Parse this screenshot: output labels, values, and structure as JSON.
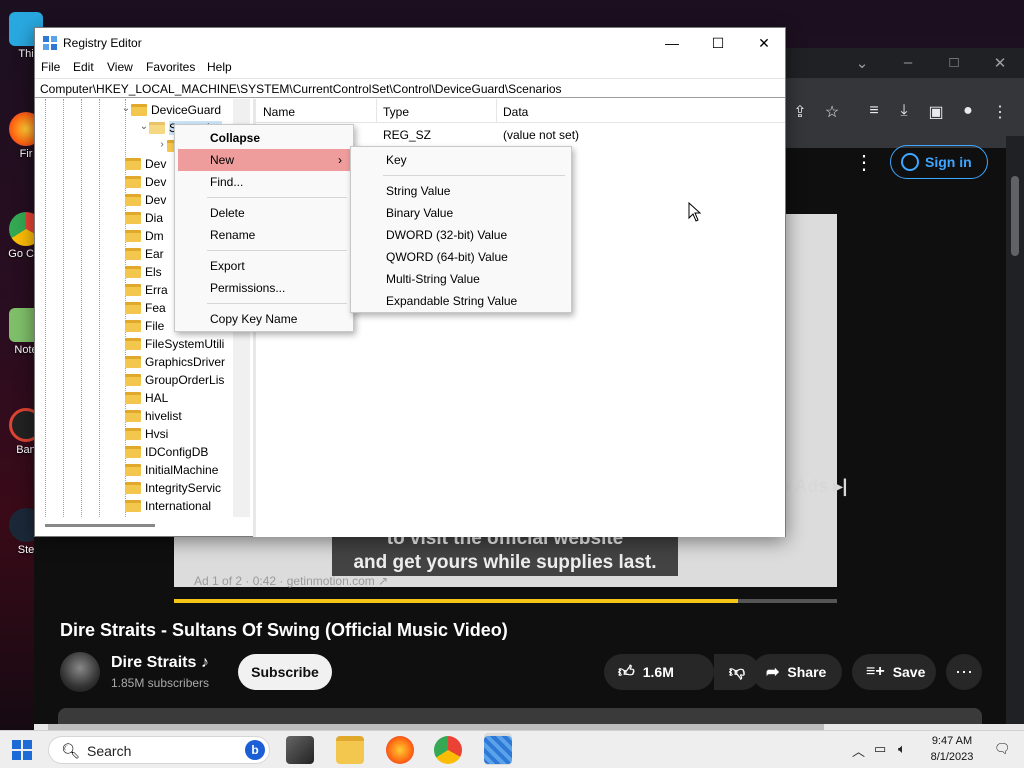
{
  "desktop": {
    "icons": [
      {
        "label": "Thi"
      },
      {
        "label": "Fir"
      },
      {
        "label": "Go Chr"
      },
      {
        "label": "Note"
      },
      {
        "label": "Ban"
      },
      {
        "label": "Ste"
      }
    ]
  },
  "browser": {
    "sign_in": "Sign in",
    "skip_ads": "ip Ads ▸|",
    "caption_line1": "to visit the official website",
    "caption_line2": "and get yours while supplies last.",
    "ad_info": "Ad 1 of 2 · 0:42 · getinmotion.com ↗",
    "progress": 0.85,
    "video_title": "Dire Straits - Sultans Of Swing (Official Music Video)",
    "channel_name": "Dire Straits ♪",
    "subscribers": "1.85M subscribers",
    "subscribe": "Subscribe",
    "likes": "1.6M",
    "share": "Share",
    "save": "Save"
  },
  "regedit": {
    "title": "Registry Editor",
    "menu": [
      "File",
      "Edit",
      "View",
      "Favorites",
      "Help"
    ],
    "address": "Computer\\HKEY_LOCAL_MACHINE\\SYSTEM\\CurrentControlSet\\Control\\DeviceGuard\\Scenarios",
    "tree": [
      {
        "label": "DeviceGuard",
        "expanded": true
      },
      {
        "label": "Scenarios",
        "expanded": true
      },
      {
        "label": "",
        "expanded": false
      },
      {
        "label": "Dev",
        "expanded": false
      },
      {
        "label": "Dev",
        "expanded": false
      },
      {
        "label": "Dev",
        "expanded": false
      },
      {
        "label": "Dia",
        "expanded": false
      },
      {
        "label": "Dm",
        "expanded": false
      },
      {
        "label": "Ear",
        "expanded": false
      },
      {
        "label": "Els",
        "expanded": false
      },
      {
        "label": "Erra",
        "expanded": false
      },
      {
        "label": "Fea",
        "expanded": false
      },
      {
        "label": "File",
        "expanded": false
      },
      {
        "label": "FileSystemUtili",
        "expanded": false
      },
      {
        "label": "GraphicsDriver",
        "expanded": false
      },
      {
        "label": "GroupOrderLis",
        "expanded": false
      },
      {
        "label": "HAL",
        "expanded": false
      },
      {
        "label": "hivelist",
        "expanded": false
      },
      {
        "label": "Hvsi",
        "expanded": false
      },
      {
        "label": "IDConfigDB",
        "expanded": false
      },
      {
        "label": "InitialMachine",
        "expanded": false
      },
      {
        "label": "IntegrityServic",
        "expanded": false
      },
      {
        "label": "International",
        "expanded": false
      }
    ],
    "columns": [
      "Name",
      "Type",
      "Data"
    ],
    "values": [
      {
        "name": "",
        "type": "REG_SZ",
        "data": "(value not set)"
      }
    ]
  },
  "context_menu": {
    "items": [
      "Collapse",
      "New",
      "Find...",
      "Delete",
      "Rename",
      "Export",
      "Permissions...",
      "Copy Key Name"
    ]
  },
  "submenu": {
    "items": [
      "Key",
      "String Value",
      "Binary Value",
      "DWORD (32-bit) Value",
      "QWORD (64-bit) Value",
      "Multi-String Value",
      "Expandable String Value"
    ]
  },
  "taskbar": {
    "search": "Search",
    "time": "9:47 AM",
    "date": "8/1/2023"
  }
}
